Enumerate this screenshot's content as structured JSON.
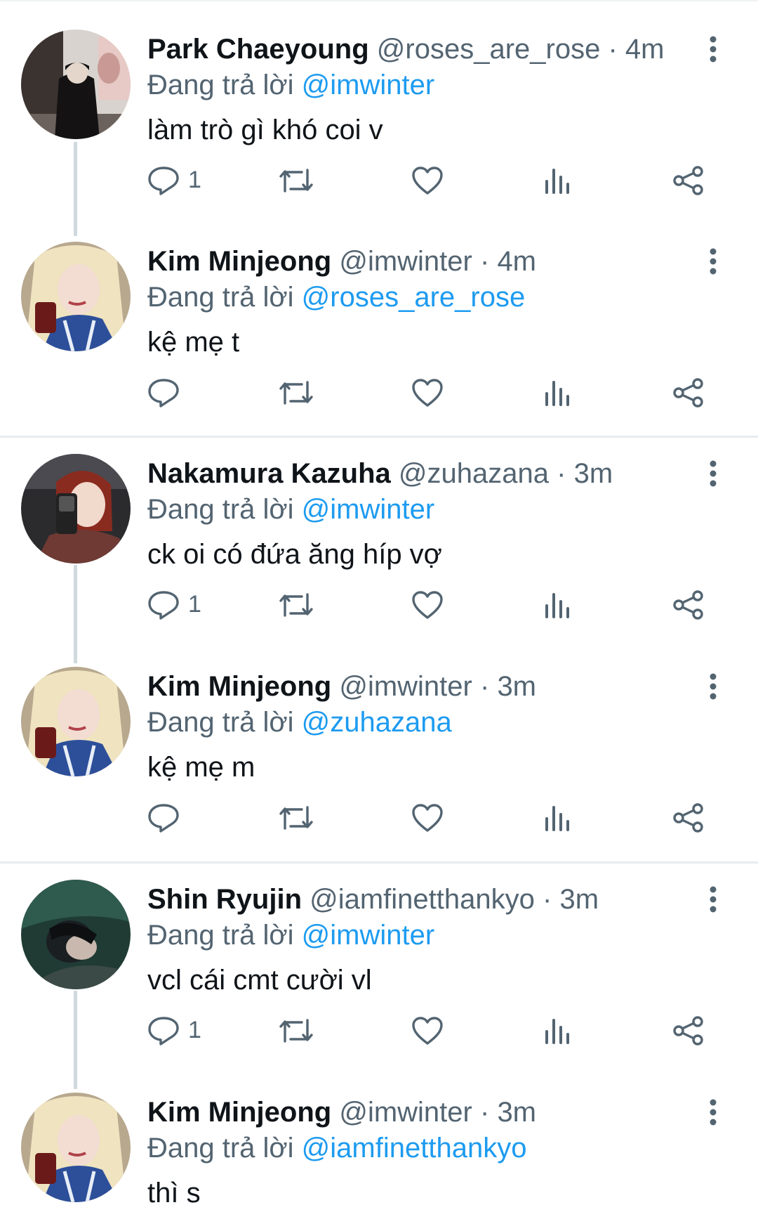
{
  "icons": [
    "reply-icon",
    "retweet-icon",
    "like-icon",
    "views-icon",
    "share-icon",
    "more-icon"
  ],
  "colors": {
    "name": "#0f1419",
    "secondary": "#536471",
    "mention": "#1d9bf0",
    "divider": "#e6ecf0",
    "thread_line": "#cfd9de"
  },
  "tweets": [
    {
      "name": "Park Chaeyoung",
      "handle": "@roses_are_rose",
      "separator": "·",
      "time": "4m",
      "replying_prefix": "Đang trả lời",
      "replying_to": "@imwinter",
      "text": "làm trò gì khó coi v",
      "reply_count": "1"
    },
    {
      "name": "Kim Minjeong",
      "handle": "@imwinter",
      "separator": "·",
      "time": "4m",
      "replying_prefix": "Đang trả lời",
      "replying_to": "@roses_are_rose",
      "text": "kệ mẹ t",
      "reply_count": ""
    },
    {
      "name": "Nakamura Kazuha",
      "handle": "@zuhazana",
      "separator": "·",
      "time": "3m",
      "replying_prefix": "Đang trả lời",
      "replying_to": "@imwinter",
      "text": "ck oi có đứa ăng híp vợ",
      "reply_count": "1"
    },
    {
      "name": "Kim Minjeong",
      "handle": "@imwinter",
      "separator": "·",
      "time": "3m",
      "replying_prefix": "Đang trả lời",
      "replying_to": "@zuhazana",
      "text": "kệ mẹ m",
      "reply_count": ""
    },
    {
      "name": "Shin Ryujin",
      "handle": "@iamfinetthankyo",
      "separator": "·",
      "time": "3m",
      "replying_prefix": "Đang trả lời",
      "replying_to": "@imwinter",
      "text": "vcl cái cmt cười vl",
      "reply_count": "1"
    },
    {
      "name": "Kim Minjeong",
      "handle": "@imwinter",
      "separator": "·",
      "time": "3m",
      "replying_prefix": "Đang trả lời",
      "replying_to": "@iamfinetthankyo",
      "text": "thì s",
      "reply_count": ""
    }
  ]
}
